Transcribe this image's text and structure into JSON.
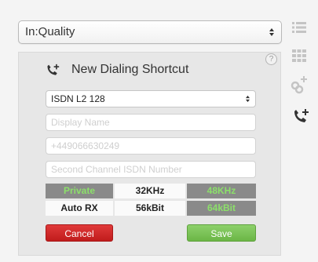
{
  "quality_select": {
    "value": "In:Quality"
  },
  "panel": {
    "help": "?",
    "title": "New Dialing Shortcut",
    "line_type": {
      "value": "ISDN L2 128"
    },
    "display_name": {
      "placeholder": "Display Name",
      "value": ""
    },
    "number": {
      "placeholder": "+449066630249",
      "value": ""
    },
    "second_channel": {
      "placeholder": "Second Channel ISDN Number",
      "value": ""
    },
    "options_row1": [
      {
        "label": "Private",
        "active": true
      },
      {
        "label": "32KHz",
        "active": false
      },
      {
        "label": "48KHz",
        "active": true
      }
    ],
    "options_row2": [
      {
        "label": "Auto RX",
        "active": false
      },
      {
        "label": "56kBit",
        "active": false
      },
      {
        "label": "64kBit",
        "active": true
      }
    ],
    "cancel_label": "Cancel",
    "save_label": "Save"
  },
  "sidebar_icons": [
    "list-icon",
    "grid-icon",
    "link-add-icon",
    "phone-add-icon"
  ],
  "colors": {
    "cancel": "#d12b2b",
    "save": "#7cc357",
    "active_cell_bg": "#8a8a8a",
    "active_cell_text": "#8ce06a"
  }
}
